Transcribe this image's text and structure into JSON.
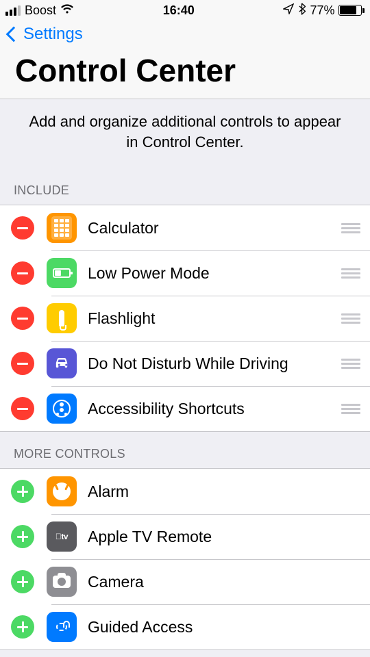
{
  "status": {
    "carrier": "Boost",
    "time": "16:40",
    "battery_pct": "77%"
  },
  "nav": {
    "back_label": "Settings"
  },
  "title": "Control Center",
  "description": "Add and organize additional controls to appear in Control Center.",
  "sections": {
    "include_header": "INCLUDE",
    "more_header": "MORE CONTROLS"
  },
  "include": [
    {
      "label": "Calculator",
      "icon": "calculator",
      "bg": "bg-orange"
    },
    {
      "label": "Low Power Mode",
      "icon": "battery",
      "bg": "bg-green"
    },
    {
      "label": "Flashlight",
      "icon": "flashlight",
      "bg": "bg-yellow"
    },
    {
      "label": "Do Not Disturb While Driving",
      "icon": "car",
      "bg": "bg-purple"
    },
    {
      "label": "Accessibility Shortcuts",
      "icon": "accessibility",
      "bg": "bg-blue"
    }
  ],
  "more": [
    {
      "label": "Alarm",
      "icon": "clock",
      "bg": "bg-orange"
    },
    {
      "label": "Apple TV Remote",
      "icon": "tv",
      "bg": "bg-darkgray"
    },
    {
      "label": "Camera",
      "icon": "camera",
      "bg": "bg-gray"
    },
    {
      "label": "Guided Access",
      "icon": "guided",
      "bg": "bg-blue"
    }
  ]
}
